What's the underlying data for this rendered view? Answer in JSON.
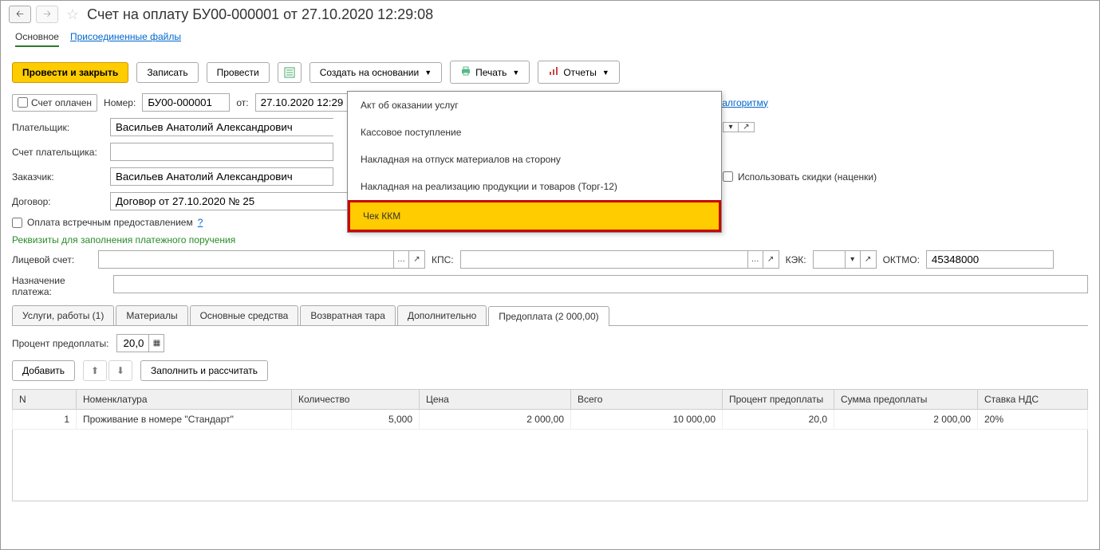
{
  "header": {
    "title": "Счет на оплату БУ00-000001 от 27.10.2020 12:29:08"
  },
  "nav": {
    "main": "Основное",
    "attached": "Присоединенные файлы"
  },
  "toolbar": {
    "post_close": "Провести и закрыть",
    "save": "Записать",
    "post": "Провести",
    "create_based": "Создать на основании",
    "print": "Печать",
    "reports": "Отчеты"
  },
  "dropdown": {
    "items": [
      "Акт об оказании услуг",
      "Кассовое поступление",
      "Накладная на отпуск материалов на сторону",
      "Накладная на реализацию продукции и товаров (Торг-12)",
      "Чек ККМ"
    ]
  },
  "form": {
    "paid_label": "Счет оплачен",
    "number_label": "Номер:",
    "number_value": "БУ00-000001",
    "date_label": "от:",
    "date_value": "27.10.2020 12:29",
    "algo_link": "нному алгоритму",
    "payer_label": "Плательщик:",
    "payer_value": "Васильев Анатолий Александрович",
    "payer_account_label": "Счет плательщика:",
    "customer_label": "Заказчик:",
    "customer_value": "Васильев Анатолий Александрович",
    "use_discounts_label": "Использовать скидки (наценки)",
    "contract_label": "Договор:",
    "contract_value": "Договор от 27.10.2020 № 25",
    "counter_pay_label": "Оплата встречным предоставлением",
    "requisites_header": "Реквизиты для заполнения платежного поручения",
    "personal_account_label": "Лицевой счет:",
    "kps_label": "КПС:",
    "kek_label": "КЭК:",
    "oktmo_label": "ОКТМО:",
    "oktmo_value": "45348000",
    "purpose_label": "Назначение платежа:"
  },
  "tabs": {
    "services": "Услуги, работы (1)",
    "materials": "Материалы",
    "assets": "Основные средства",
    "tare": "Возвратная тара",
    "additional": "Дополнительно",
    "prepayment": "Предоплата (2 000,00)"
  },
  "prepay": {
    "percent_label": "Процент предоплаты:",
    "percent_value": "20,0",
    "add": "Добавить",
    "fill": "Заполнить и рассчитать"
  },
  "table": {
    "headers": {
      "n": "N",
      "nomenclature": "Номенклатура",
      "qty": "Количество",
      "price": "Цена",
      "total": "Всего",
      "prepay_pct": "Процент предоплаты",
      "prepay_sum": "Сумма предоплаты",
      "vat": "Ставка НДС"
    },
    "rows": [
      {
        "n": "1",
        "nomenclature": "Проживание в номере \"Стандарт\"",
        "qty": "5,000",
        "price": "2 000,00",
        "total": "10 000,00",
        "prepay_pct": "20,0",
        "prepay_sum": "2 000,00",
        "vat": "20%"
      }
    ]
  }
}
